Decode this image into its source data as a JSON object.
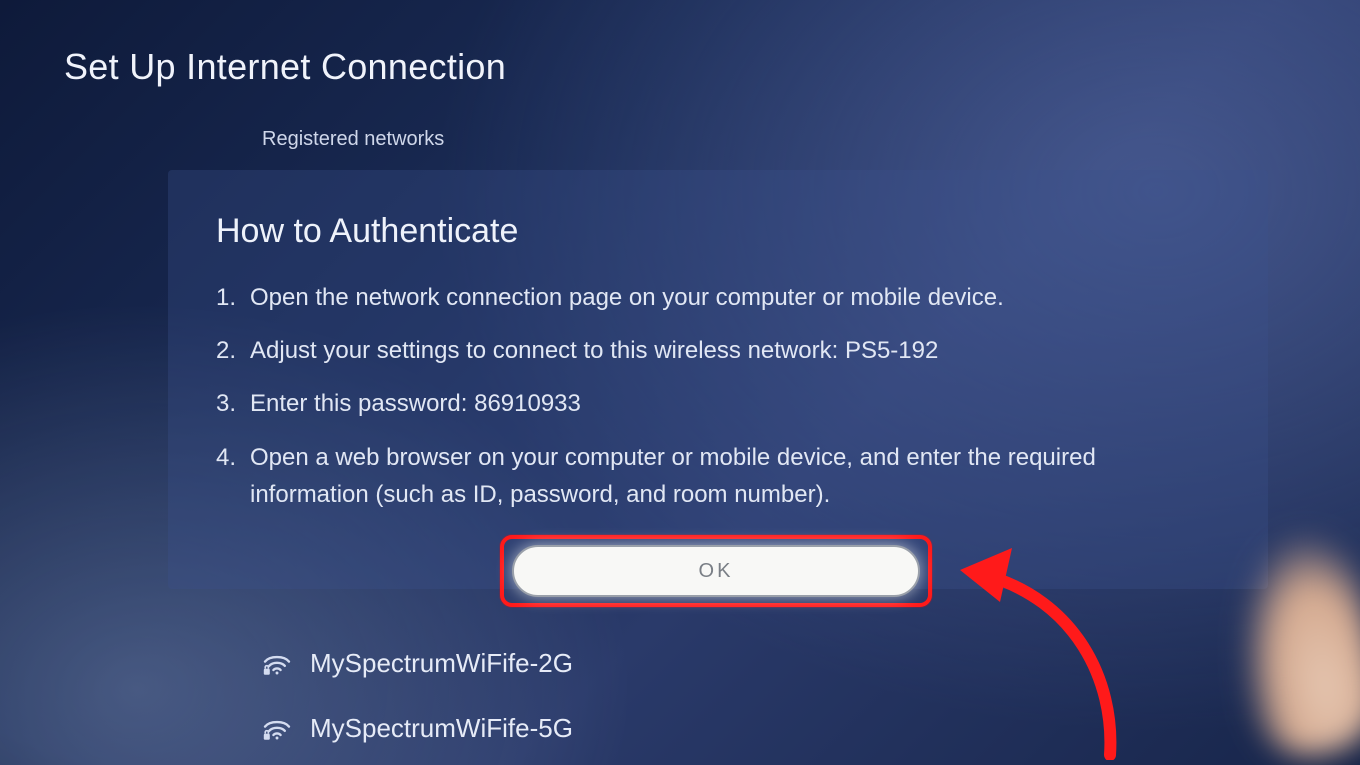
{
  "page_title": "Set Up Internet Connection",
  "section_label": "Registered networks",
  "dialog": {
    "title": "How to Authenticate",
    "steps": [
      "Open the network connection page on your computer or mobile device.",
      "Adjust your settings to connect to this wireless network: PS5-192",
      "Enter this password: 86910933",
      "Open a web browser on your computer or mobile device, and enter the required information (such as ID, password, and room number)."
    ],
    "ok_label": "OK"
  },
  "networks": [
    {
      "name": "MySpectrumWiFife-2G"
    },
    {
      "name": "MySpectrumWiFife-5G"
    }
  ],
  "annotation": {
    "highlight_color": "#ff1a1a",
    "arrow_points_to": "ok-button"
  }
}
